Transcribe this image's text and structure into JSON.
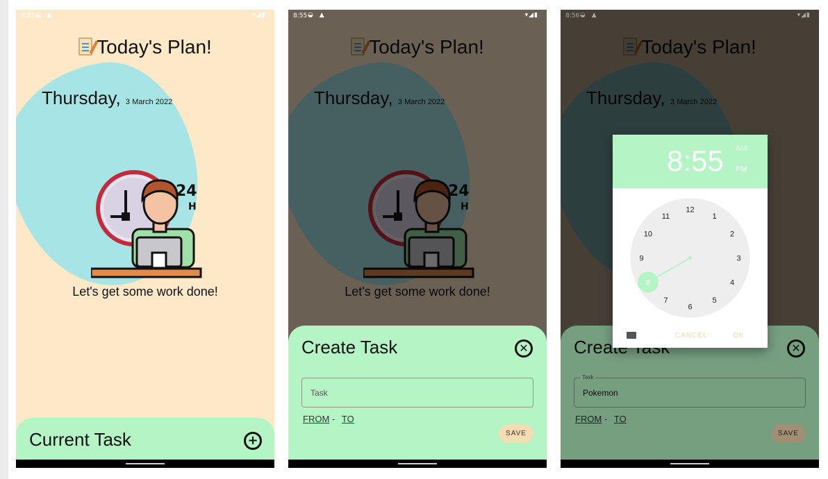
{
  "colors": {
    "background": "#fde8c8",
    "blob": "#a7e4e6",
    "accent_green": "#b5f5c5",
    "save_button": "#f6dcb2"
  },
  "status": {
    "screen1_time": "8:55",
    "screen2_time": "8:55",
    "screen3_time": "8:56"
  },
  "home": {
    "title": "Today's Plan!",
    "title_icon": "notepad-icon",
    "weekday": "Thursday,",
    "date": "3 March 2022",
    "tagline": "Let's get some work done!",
    "illustration": "person-at-laptop-24h-clock-illustration",
    "bottom_card_title": "Current Task",
    "add_icon": "plus-circle-icon"
  },
  "create_task": {
    "title": "Create Task",
    "close_icon": "close-circle-icon",
    "task_placeholder": "Task",
    "task_label": "Task",
    "task_value": "Pokemon",
    "from_label": "FROM",
    "separator": "-",
    "to_label": "TO",
    "save_label": "SAVE"
  },
  "time_picker": {
    "time": "8:55",
    "am_label": "AM",
    "pm_label": "PM",
    "selected_hour": 8,
    "hours": [
      "12",
      "1",
      "2",
      "3",
      "4",
      "5",
      "6",
      "7",
      "8",
      "9",
      "10",
      "11"
    ],
    "cancel_label": "CANCEL",
    "ok_label": "OK",
    "keyboard_icon": "keyboard-icon"
  }
}
